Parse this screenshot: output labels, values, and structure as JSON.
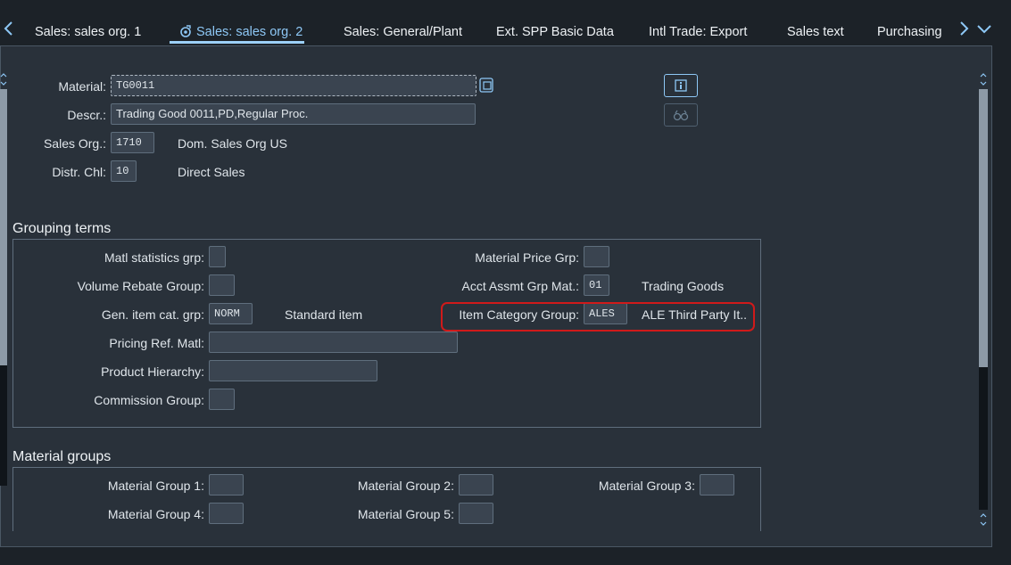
{
  "tabs": [
    {
      "label": "Sales: sales org. 1",
      "active": false
    },
    {
      "label": "Sales: sales org. 2",
      "active": true
    },
    {
      "label": "Sales: General/Plant",
      "active": false
    },
    {
      "label": "Ext. SPP Basic Data",
      "active": false
    },
    {
      "label": "Intl Trade: Export",
      "active": false
    },
    {
      "label": "Sales text",
      "active": false
    },
    {
      "label": "Purchasing",
      "active": false
    }
  ],
  "header": {
    "material": {
      "label": "Material:",
      "value": "TG0011"
    },
    "descr": {
      "label": "Descr.:",
      "value": "Trading Good 0011,PD,Regular Proc."
    },
    "sales_org": {
      "label": "Sales Org.:",
      "value": "1710",
      "text": "Dom. Sales Org US"
    },
    "distr_chl": {
      "label": "Distr. Chl:",
      "value": "10",
      "text": "Direct Sales"
    }
  },
  "grouping_terms": {
    "title": "Grouping terms",
    "matl_statistics_grp": {
      "label": "Matl statistics grp:",
      "value": ""
    },
    "volume_rebate_group": {
      "label": "Volume Rebate Group:",
      "value": ""
    },
    "gen_item_cat_grp": {
      "label": "Gen. item cat. grp:",
      "value": "NORM",
      "text": "Standard item"
    },
    "pricing_ref_matl": {
      "label": "Pricing Ref. Matl:",
      "value": ""
    },
    "product_hierarchy": {
      "label": "Product Hierarchy:",
      "value": ""
    },
    "commission_group": {
      "label": "Commission Group:",
      "value": ""
    },
    "material_price_grp": {
      "label": "Material Price Grp:",
      "value": ""
    },
    "acct_assmt_grp_mat": {
      "label": "Acct Assmt Grp Mat.:",
      "value": "01",
      "text": "Trading Goods"
    },
    "item_category_group": {
      "label": "Item Category Group:",
      "value": "ALES",
      "text": "ALE Third Party It..."
    }
  },
  "material_groups": {
    "title": "Material groups",
    "mg1": {
      "label": "Material Group 1:",
      "value": ""
    },
    "mg2": {
      "label": "Material Group 2:",
      "value": ""
    },
    "mg3": {
      "label": "Material Group 3:",
      "value": ""
    },
    "mg4": {
      "label": "Material Group 4:",
      "value": ""
    },
    "mg5": {
      "label": "Material Group 5:",
      "value": ""
    }
  },
  "icons": {
    "tab_prev": "chevron-left-icon",
    "tab_next": "chevron-right-icon",
    "tab_menu": "chevron-down-icon",
    "active_tab": "settings-wheel-icon",
    "info": "info-icon",
    "glasses": "glasses-icon",
    "copy": "copy-icon"
  },
  "colors": {
    "accent": "#8ec8f6",
    "highlight": "#d01a1a",
    "background": "#29313a"
  }
}
